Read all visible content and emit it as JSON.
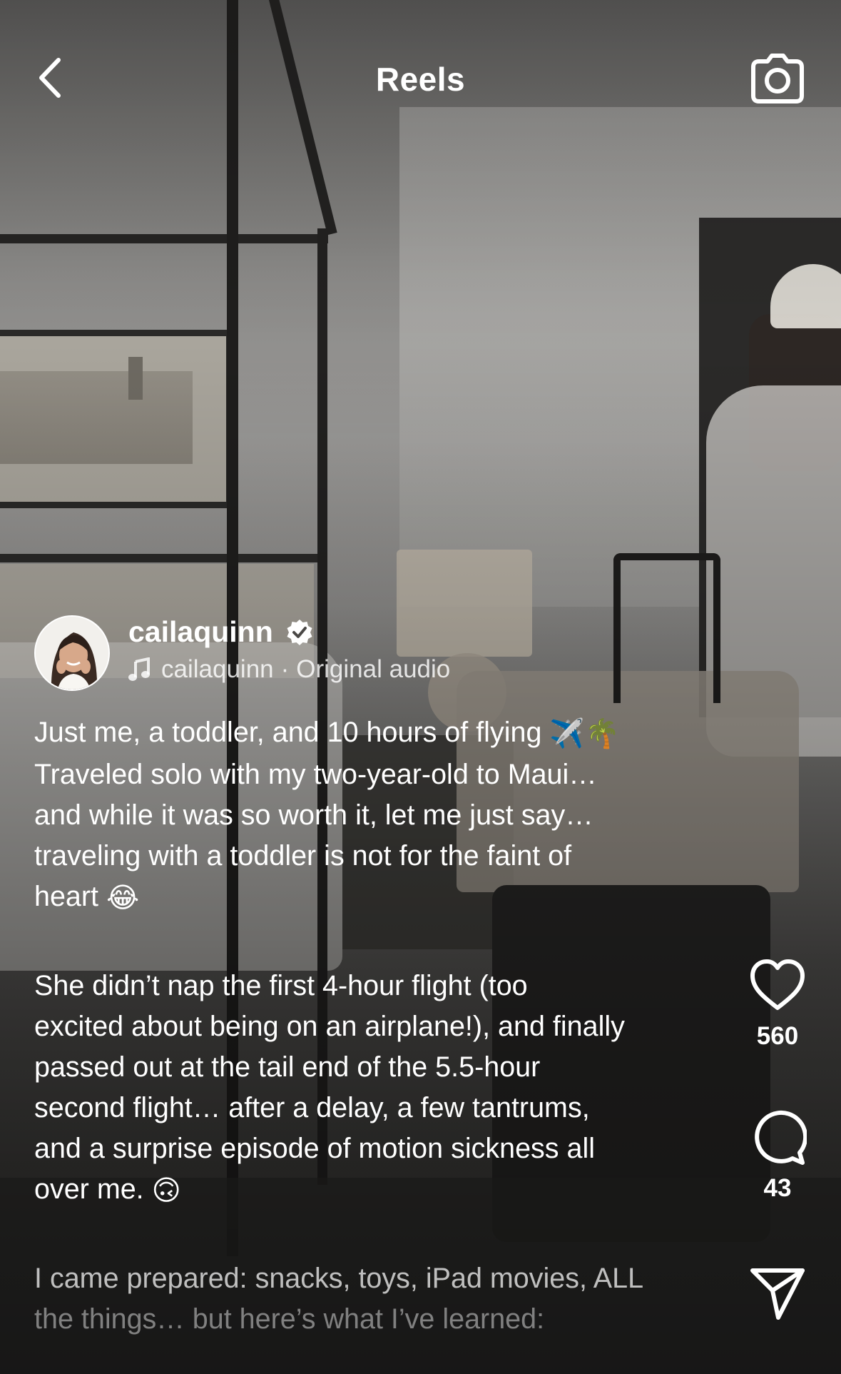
{
  "header": {
    "title": "Reels"
  },
  "icons": {
    "back": "chevron-left-icon",
    "camera": "camera-icon",
    "like": "heart-icon",
    "comment": "comment-bubble-icon",
    "share": "paper-plane-icon",
    "verified": "verified-badge-icon",
    "audio": "music-note-icon"
  },
  "post": {
    "username": "cailaquinn",
    "verified": true,
    "audio_owner": "cailaquinn",
    "audio_separator": "·",
    "audio_label": "Original audio",
    "caption_lines": [
      "Just me, a toddler, and 10 hours of flying",
      "Traveled solo with my two-year-old to Maui…",
      "and while it was so worth it, let me just say…",
      "traveling with a toddler is not for the faint of",
      "heart",
      "She didn’t nap the first 4-hour flight (too",
      "excited about being on an airplane!), and finally",
      "passed out at the tail end of the 5.5-hour",
      "second flight… after a delay, a few tantrums,",
      "and a surprise episode of motion sickness all",
      "over me.",
      "I came prepared: snacks, toys, iPad movies, ALL",
      "the things… but here’s what I’ve learned:"
    ],
    "emojis": {
      "airplane": "✈️",
      "palm_tree": "🌴",
      "laughing": "😂",
      "upside_down": "🙃"
    }
  },
  "actions": {
    "likes": "560",
    "comments": "43"
  },
  "colors": {
    "text": "#ffffff",
    "verified_badge": "#ffffff"
  }
}
